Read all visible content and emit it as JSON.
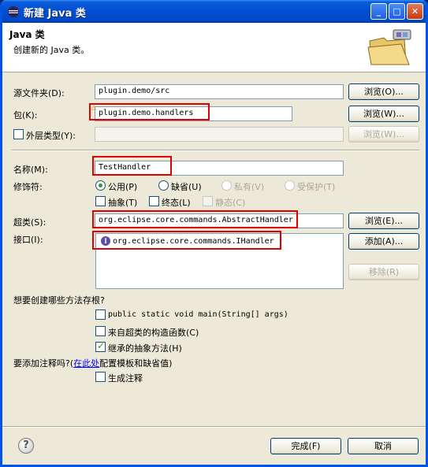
{
  "window": {
    "title": "新建 Java 类",
    "controls": {
      "minimize": "_",
      "maximize": "□",
      "close": "✕"
    }
  },
  "header": {
    "title": "Java 类",
    "description": "创建新的 Java 类。"
  },
  "form": {
    "source_folder": {
      "label": "源文件夹(D):",
      "value": "plugin.demo/src",
      "browse": "浏览(O)..."
    },
    "package": {
      "label": "包(K):",
      "value": "plugin.demo.handlers",
      "browse": "浏览(W)..."
    },
    "enclosing_type": {
      "label": "外层类型(Y):",
      "value": "",
      "browse": "浏览(W)...",
      "checked": false
    },
    "name": {
      "label": "名称(M):",
      "value": "TestHandler"
    },
    "modifiers": {
      "label": "修饰符:",
      "public": "公用(P)",
      "default": "缺省(U)",
      "private": "私有(V)",
      "protected": "受保护(T)",
      "abstract": "抽象(T)",
      "final": "终态(L)",
      "static": "静态(C)",
      "selected": "public"
    },
    "superclass": {
      "label": "超类(S):",
      "value": "org.eclipse.core.commands.AbstractHandler",
      "browse": "浏览(E)..."
    },
    "interfaces": {
      "label": "接口(I):",
      "items": [
        "org.eclipse.core.commands.IHandler"
      ],
      "add": "添加(A)...",
      "remove": "移除(R)"
    },
    "stubs": {
      "question": "想要创建哪些方法存根?",
      "main": "public static void main(String[] args)",
      "constructors": "来自超类的构造函数(C)",
      "inherited": "继承的抽象方法(H)",
      "main_checked": false,
      "constructors_checked": false,
      "inherited_checked": true
    },
    "comments": {
      "question_prefix": "要添加注释吗?(",
      "link": "在此处",
      "question_suffix": "配置模板和缺省值)",
      "generate": "生成注释",
      "generate_checked": false
    }
  },
  "footer": {
    "help": "?",
    "finish": "完成(F)",
    "cancel": "取消"
  },
  "colors": {
    "highlight_box": "#e00000",
    "titlebar": "#0450d2",
    "dialog_bg": "#ece9d8"
  }
}
